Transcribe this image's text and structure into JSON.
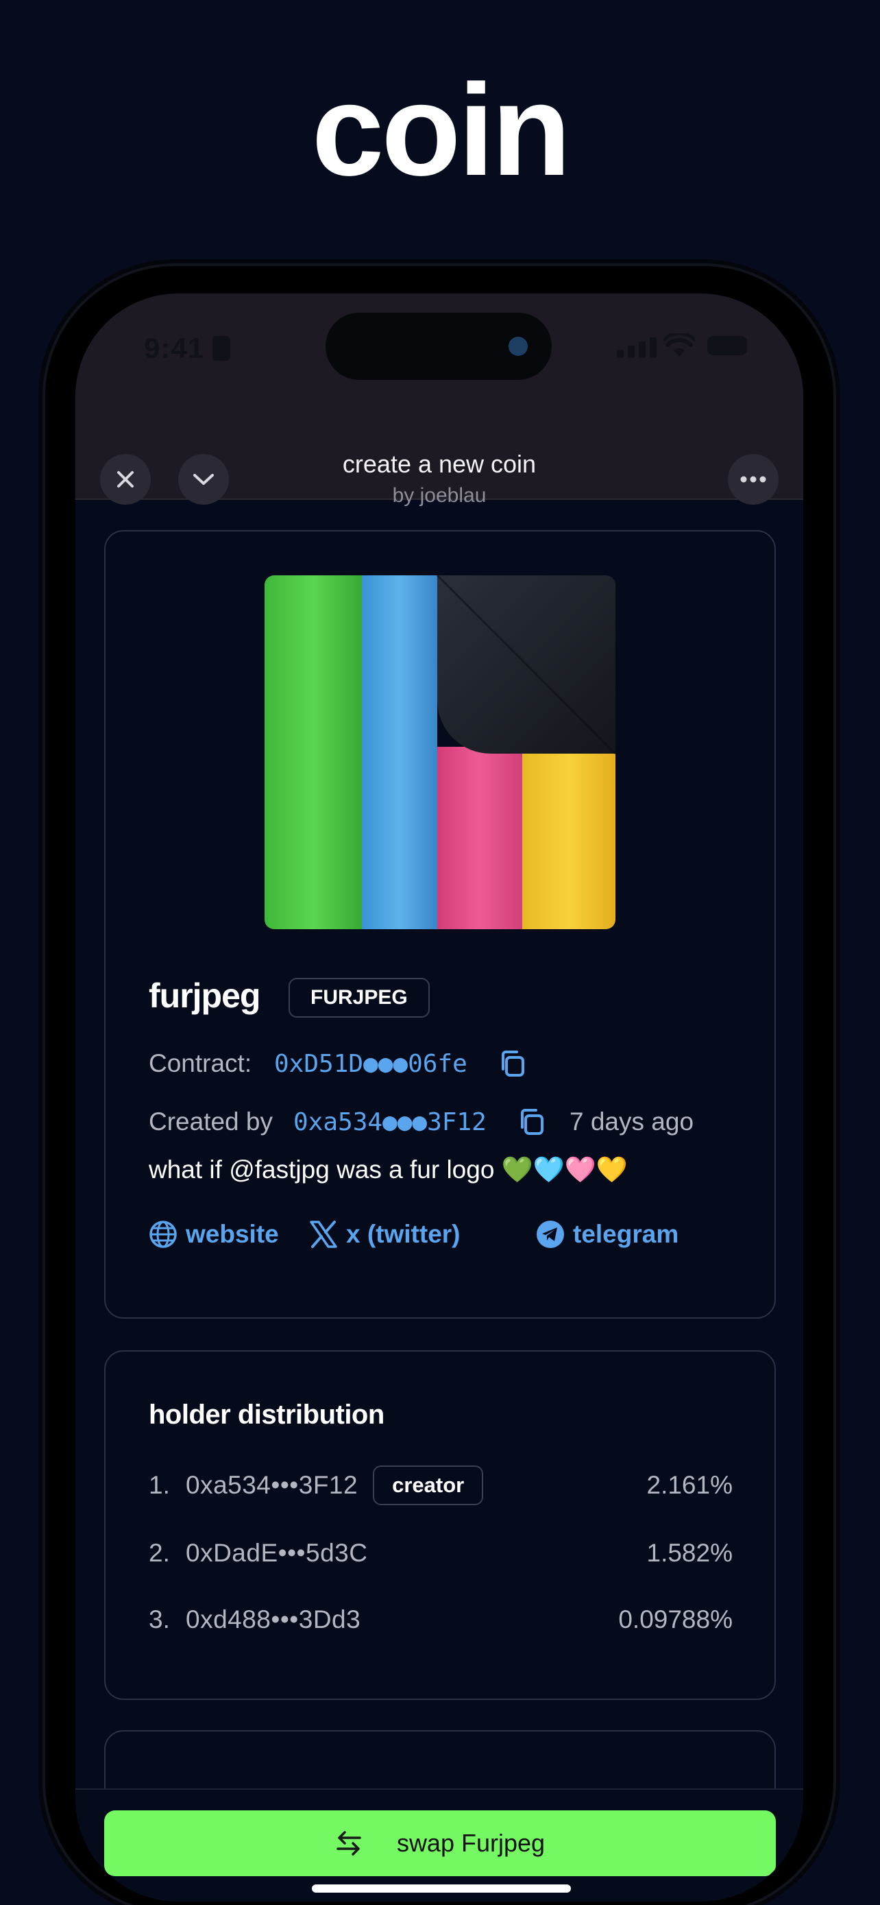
{
  "hero": {
    "title": "coin"
  },
  "status_bar": {
    "time": "9:41"
  },
  "header": {
    "title": "create a new coin",
    "subtitle": "by joeblau"
  },
  "coin": {
    "name": "furjpeg",
    "ticker": "FURJPEG",
    "contract_label": "Contract:",
    "contract_address": "0xD51D●●●06fe",
    "created_by_label": "Created by",
    "creator_address": "0xa534●●●3F12",
    "created_ago": "7 days ago",
    "description": "what if @fastjpg was a fur logo 💚🩵🩷💛",
    "links": {
      "website": "website",
      "twitter": "x (twitter)",
      "telegram": "telegram"
    }
  },
  "holders": {
    "title": "holder distribution",
    "rows": [
      {
        "rank": "1.",
        "address": "0xa534•••3F12",
        "badge": "creator",
        "percent": "2.161%"
      },
      {
        "rank": "2.",
        "address": "0xDadE•••5d3C",
        "percent": "1.582%"
      },
      {
        "rank": "3.",
        "address": "0xd488•••3Dd3",
        "percent": "0.09788%"
      }
    ]
  },
  "swap": {
    "label": "swap Furjpeg"
  },
  "colors": {
    "accent_link": "#5aa5ee",
    "swap_green": "#74f963",
    "background": "#060b1e"
  }
}
